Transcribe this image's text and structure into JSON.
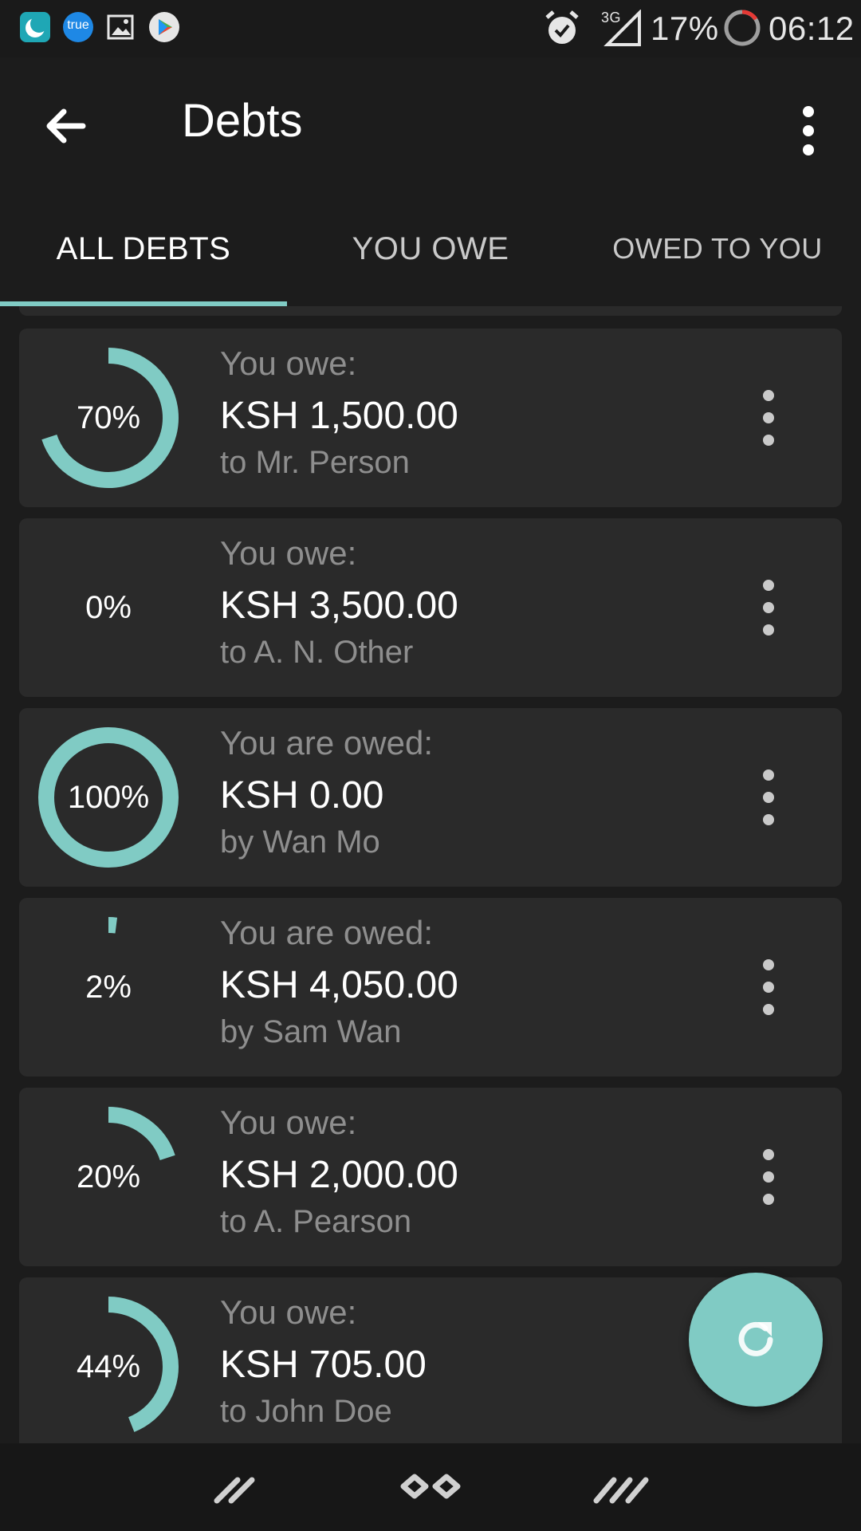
{
  "status_bar": {
    "left_icons": [
      "moon-app-icon",
      "true-app-icon",
      "image-icon",
      "play-store-icon"
    ],
    "true_label": "true",
    "battery_percent": "17%",
    "network_type": "3G",
    "time": "06:12",
    "right_icons": [
      "alarm-icon",
      "signal-icon",
      "battery-ring-icon"
    ]
  },
  "app_bar": {
    "title": "Debts",
    "back_icon": "arrow-back-icon",
    "menu_icon": "more-vert-icon"
  },
  "tabs": [
    {
      "label": "ALL DEBTS",
      "active": true
    },
    {
      "label": "YOU OWE",
      "active": false
    },
    {
      "label": "OWED TO YOU",
      "active": false
    }
  ],
  "debts": [
    {
      "percent_label": "70%",
      "progress": 0.7,
      "label": "You owe:",
      "amount": "KSH 1,500.00",
      "party": "to Mr. Person"
    },
    {
      "percent_label": "0%",
      "progress": 0.0,
      "label": "You owe:",
      "amount": "KSH 3,500.00",
      "party": "to A. N. Other"
    },
    {
      "percent_label": "100%",
      "progress": 1.0,
      "label": "You are owed:",
      "amount": "KSH 0.00",
      "party": "by Wan Mo"
    },
    {
      "percent_label": "2%",
      "progress": 0.02,
      "label": "You are owed:",
      "amount": "KSH 4,050.00",
      "party": "by Sam Wan"
    },
    {
      "percent_label": "20%",
      "progress": 0.2,
      "label": "You owe:",
      "amount": "KSH 2,000.00",
      "party": "to A. Pearson"
    },
    {
      "percent_label": "44%",
      "progress": 0.44,
      "label": "You owe:",
      "amount": "KSH 705.00",
      "party": "to John Doe"
    }
  ],
  "fab": {
    "icon": "refresh-icon"
  },
  "nav_bar": {
    "icons": [
      "nav-back-icon",
      "nav-home-icon",
      "nav-recents-icon"
    ]
  },
  "colors": {
    "accent": "#80cbc4",
    "background": "#1c1c1c",
    "card": "#2a2a2a",
    "secondary_text": "#8e8e8e"
  }
}
